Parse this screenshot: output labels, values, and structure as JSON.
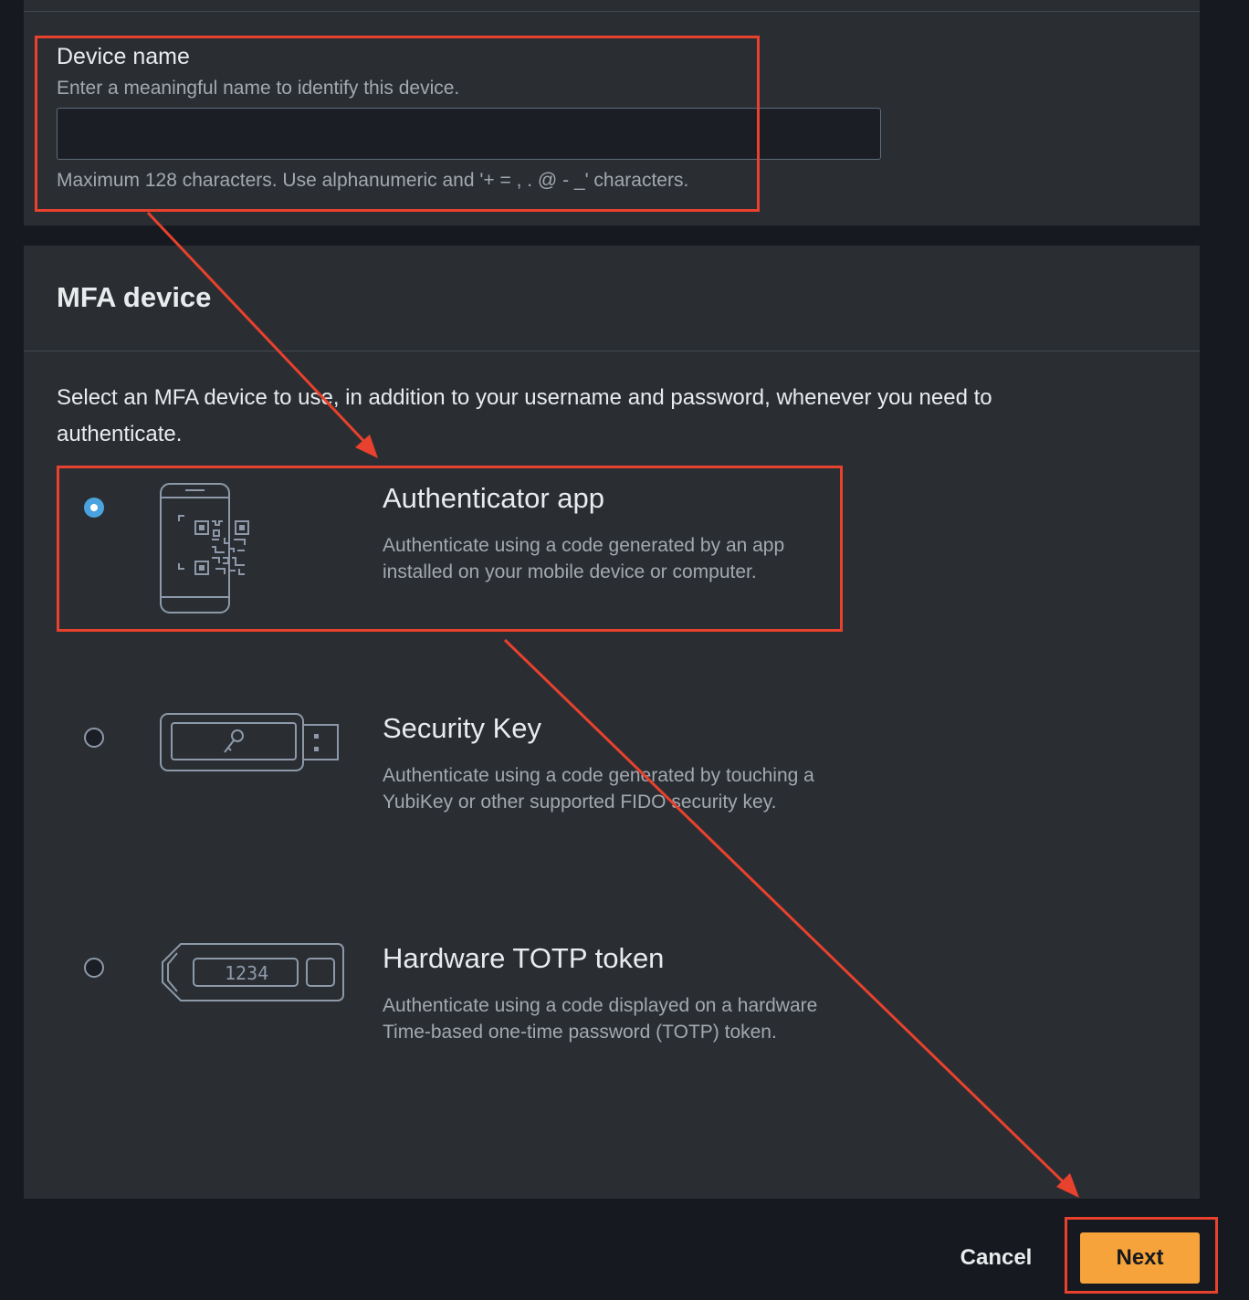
{
  "device_name": {
    "label": "Device name",
    "description": "Enter a meaningful name to identify this device.",
    "value": "",
    "constraint": "Maximum 128 characters. Use alphanumeric and '+ = , . @ - _' characters."
  },
  "mfa_section": {
    "title": "MFA device",
    "description": "Select an MFA device to use, in addition to your username and password, whenever you need to authenticate.",
    "options": [
      {
        "title": "Authenticator app",
        "description": "Authenticate using a code generated by an app installed on your mobile device or computer.",
        "icon": "phone-qr-icon",
        "selected": true
      },
      {
        "title": "Security Key",
        "description": "Authenticate using a code generated by touching a YubiKey or other supported FIDO security key.",
        "icon": "usb-security-key-icon",
        "selected": false
      },
      {
        "title": "Hardware TOTP token",
        "description": "Authenticate using a code displayed on a hardware Time-based one-time password (TOTP) token.",
        "icon": "totp-token-icon",
        "token_display": "1234",
        "selected": false
      }
    ]
  },
  "actions": {
    "cancel_label": "Cancel",
    "next_label": "Next"
  },
  "colors": {
    "accent": "#f5a33a",
    "radio_selected": "#4aa3df",
    "annotation": "#e8412d",
    "panel_bg": "#2a2e33",
    "page_bg": "#16191f"
  }
}
